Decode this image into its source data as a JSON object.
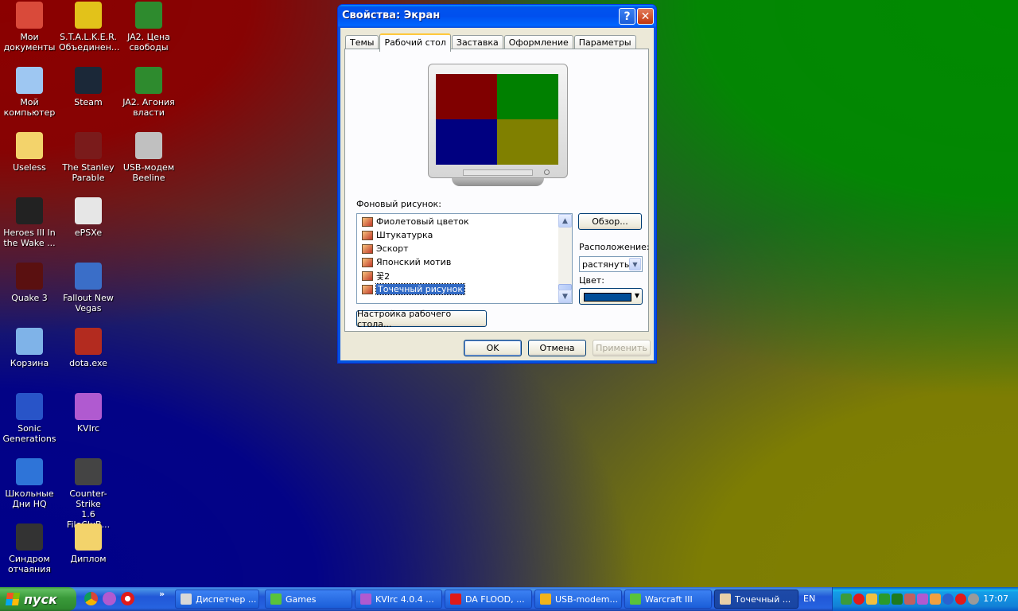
{
  "desktop": {
    "icons": [
      {
        "label": "Мои\nдокументы",
        "glyph": "folder-documents-icon",
        "color": "#d94a3a"
      },
      {
        "label": "S.T.A.L.K.E.R.\nОбъединен...",
        "glyph": "radiation-icon",
        "color": "#e2c21a"
      },
      {
        "label": "JA2. Цена\nсвободы",
        "glyph": "ja2-icon",
        "color": "#2e8b2e"
      },
      {
        "label": "Мой\nкомпьютер",
        "glyph": "computer-icon",
        "color": "#9ec7f2"
      },
      {
        "label": "Steam",
        "glyph": "steam-icon",
        "color": "#1b2838"
      },
      {
        "label": "JA2. Агония\nвласти",
        "glyph": "ja2-icon",
        "color": "#2e8b2e"
      },
      {
        "label": "Useless",
        "glyph": "folder-icon",
        "color": "#f3d36b"
      },
      {
        "label": "The Stanley\nParable",
        "glyph": "stanley-icon",
        "color": "#7a1b1b"
      },
      {
        "label": "USB-модем\nBeeline",
        "glyph": "modem-icon",
        "color": "#c0c0c0"
      },
      {
        "label": "Heroes III In\nthe Wake ...",
        "glyph": "eye-icon",
        "color": "#222222"
      },
      {
        "label": "ePSXe",
        "glyph": "gamepad-icon",
        "color": "#e6e6e6"
      },
      {
        "label": "Quake 3",
        "glyph": "quake-icon",
        "color": "#5a1010"
      },
      {
        "label": "Fallout New\nVegas",
        "glyph": "vault-boy-icon",
        "color": "#3a6ec8"
      },
      {
        "label": "Корзина",
        "glyph": "recycle-bin-icon",
        "color": "#7fb3e8"
      },
      {
        "label": "dota.exe",
        "glyph": "dota-icon",
        "color": "#b32b1f"
      },
      {
        "label": "Sonic\nGenerations",
        "glyph": "sonic-icon",
        "color": "#2854c8"
      },
      {
        "label": "KVIrc",
        "glyph": "kvirc-icon",
        "color": "#b05ad0"
      },
      {
        "label": "Школьные\nДни HQ",
        "glyph": "phone-icon",
        "color": "#2e74d8"
      },
      {
        "label": "Counter-Strike\n1.6 FileCluB...",
        "glyph": "counter-strike-icon",
        "color": "#444444"
      },
      {
        "label": "Синдром\nотчаяния",
        "glyph": "syndrome-icon",
        "color": "#333333"
      },
      {
        "label": "Диплом",
        "glyph": "folder-icon",
        "color": "#f3d36b"
      }
    ]
  },
  "dialog": {
    "title": "Свойства: Экран",
    "help_label": "?",
    "close_label": "✕",
    "tabs": [
      {
        "label": "Темы",
        "active": false
      },
      {
        "label": "Рабочий стол",
        "active": true
      },
      {
        "label": "Заставка",
        "active": false
      },
      {
        "label": "Оформление",
        "active": false
      },
      {
        "label": "Параметры",
        "active": false
      }
    ],
    "preview_colors": [
      "#800000",
      "#008000",
      "#000080",
      "#808000"
    ],
    "background_label": "Фоновый рисунок:",
    "background_items": [
      {
        "label": "Фиолетовый цветок",
        "selected": false
      },
      {
        "label": "Штукатурка",
        "selected": false
      },
      {
        "label": "Эскорт",
        "selected": false
      },
      {
        "label": "Японский мотив",
        "selected": false
      },
      {
        "label": "꽃2",
        "selected": false
      },
      {
        "label": "Точечный рисунок",
        "selected": true
      }
    ],
    "browse_label": "Обзор...",
    "position_label": "Расположение:",
    "position_value": "растянуть",
    "color_label": "Цвет:",
    "color_value": "#004e98",
    "customize_label": "Настройка рабочего стола...",
    "ok_label": "OK",
    "cancel_label": "Отмена",
    "apply_label": "Применить"
  },
  "taskbar": {
    "start_label": "пуск",
    "quicklaunch_more": "»",
    "tasks": [
      {
        "label": "Диспетчер ...",
        "icon": "task-manager-icon",
        "color": "#d8d8d8",
        "active": false
      },
      {
        "label": "Games",
        "icon": "folder-icon",
        "color": "#59c33b",
        "active": false
      },
      {
        "label": "KVIrc 4.0.4 ...",
        "icon": "kvirc-icon",
        "color": "#b05ad0",
        "active": false
      },
      {
        "label": "DA FLOOD, ...",
        "icon": "opera-icon",
        "color": "#e01a1a",
        "active": false
      },
      {
        "label": "USB-modem...",
        "icon": "chrome-icon",
        "color": "#f1b31c",
        "active": false
      },
      {
        "label": "Warcraft III",
        "icon": "folder-icon",
        "color": "#59c33b",
        "active": false
      },
      {
        "label": "Точечный ...",
        "icon": "paint-icon",
        "color": "#e8d0a8",
        "active": true
      }
    ],
    "language": "EN",
    "clock": "17:07"
  }
}
